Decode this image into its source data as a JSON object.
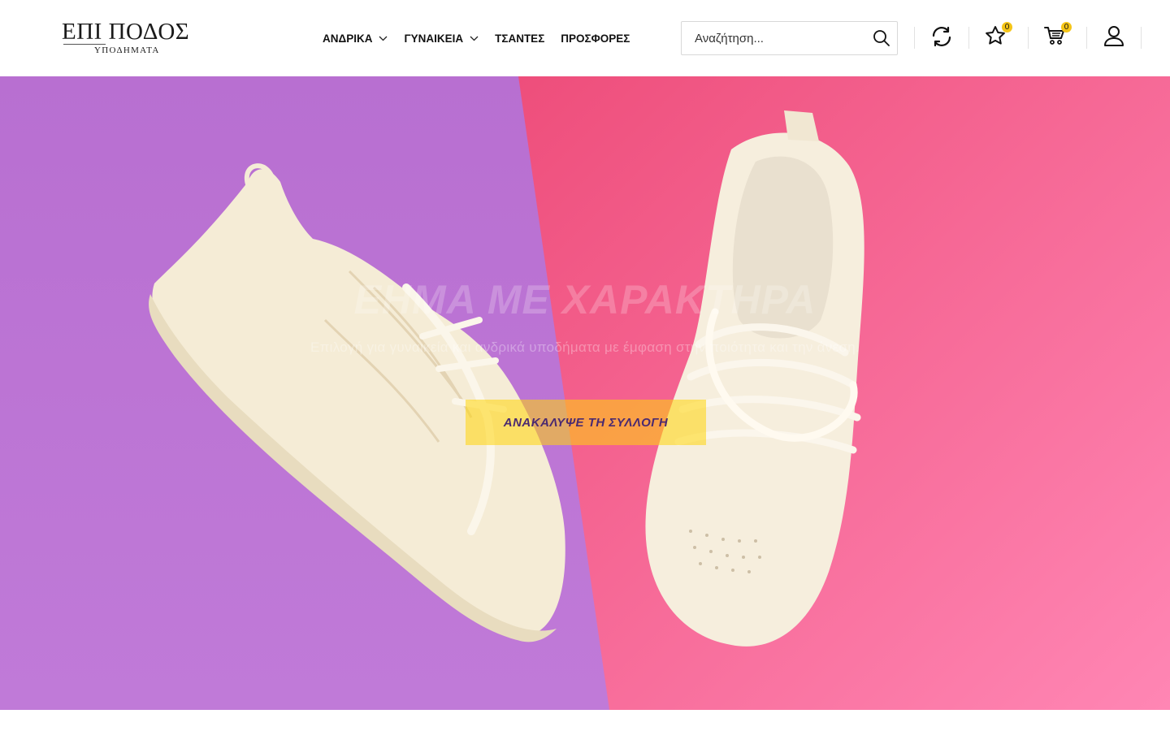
{
  "header": {
    "logo": {
      "title": "ΕΠΙ ΠΟΔΟΣ",
      "subtitle": "ΥΠΟΔΗΜΑΤΑ"
    },
    "nav": [
      {
        "label": "ΑΝΔΡΙΚΑ",
        "has_dropdown": true
      },
      {
        "label": "ΓΥΝΑΙΚΕΙΑ",
        "has_dropdown": true
      },
      {
        "label": "ΤΣΑΝΤΕΣ",
        "has_dropdown": false
      },
      {
        "label": "ΠΡΟΣΦΟΡΕΣ",
        "has_dropdown": false
      }
    ],
    "search": {
      "placeholder": "Αναζήτηση...",
      "value": "",
      "icon": "search-icon"
    },
    "actions": {
      "compare": {
        "icon": "refresh-icon"
      },
      "wishlist": {
        "icon": "star-icon",
        "count": "0"
      },
      "cart": {
        "icon": "cart-icon",
        "count": "0"
      },
      "account": {
        "icon": "user-icon"
      }
    },
    "badge_color": "#f5c518"
  },
  "hero": {
    "title": "ΕΗΜΑ ΜΕ ΧΑΡΑΚΤΗΡΑ",
    "subtitle": "Επιλογή για γυναικεία και ανδρικά υποδήματα με έμφαση στην ποιότητα και την άνεση.",
    "cta_label": "ΑΝΑΚΑΛΥΨΕ ΤΗ ΣΥΛΛΟΓΗ",
    "colors": {
      "left_bg": "#b56fd3",
      "right_bg": "#ee5a8a",
      "cta_bg": "#ffd60a",
      "cta_text": "#4a2a70"
    }
  }
}
